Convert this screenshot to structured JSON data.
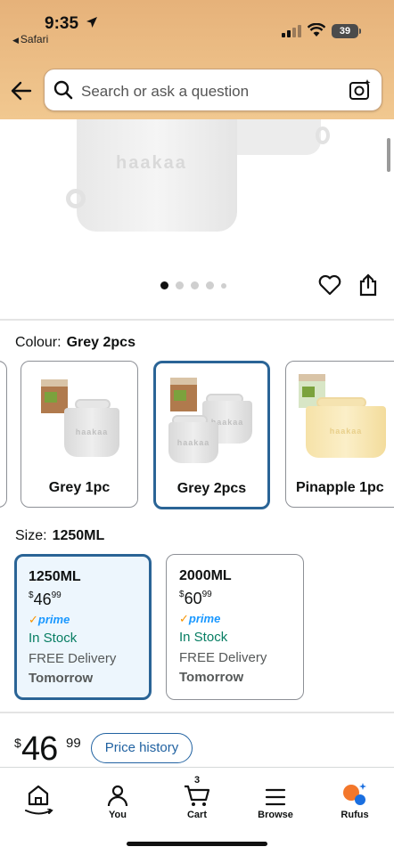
{
  "status_bar": {
    "time": "9:35",
    "back_app": "Safari",
    "battery": "39"
  },
  "search": {
    "placeholder": "Search or ask a question"
  },
  "product_image": {
    "logo_text": "haakaa",
    "active_dot": 1,
    "dot_count": 5
  },
  "colour": {
    "label": "Colour:",
    "selected": "Grey 2pcs",
    "options": [
      {
        "name": "Grey 1pc"
      },
      {
        "name": "Grey 2pcs"
      },
      {
        "name": "Pinapple 1pc"
      }
    ]
  },
  "size": {
    "label": "Size:",
    "selected": "1250ML",
    "options": [
      {
        "size": "1250ML",
        "currency": "$",
        "price_whole": "46",
        "price_cents": "99",
        "prime": "prime",
        "stock": "In Stock",
        "delivery": "FREE Delivery",
        "day": "Tomorrow"
      },
      {
        "size": "2000ML",
        "currency": "$",
        "price_whole": "60",
        "price_cents": "99",
        "prime": "prime",
        "stock": "In Stock",
        "delivery": "FREE Delivery",
        "day": "Tomorrow"
      }
    ]
  },
  "price": {
    "currency": "$",
    "whole": "46",
    "cents": "99",
    "history_label": "Price history"
  },
  "nav": {
    "items": [
      {
        "label": "",
        "icon": "home-icon"
      },
      {
        "label": "You",
        "icon": "user-icon"
      },
      {
        "label": "Cart",
        "icon": "cart-icon",
        "count": "3"
      },
      {
        "label": "Browse",
        "icon": "menu-icon"
      },
      {
        "label": "Rufus",
        "icon": "rufus-icon"
      }
    ]
  },
  "colors": {
    "header": "#e6b27a",
    "selected_border": "#2a6496",
    "stock_green": "#067d62",
    "link_blue": "#2162a1"
  }
}
